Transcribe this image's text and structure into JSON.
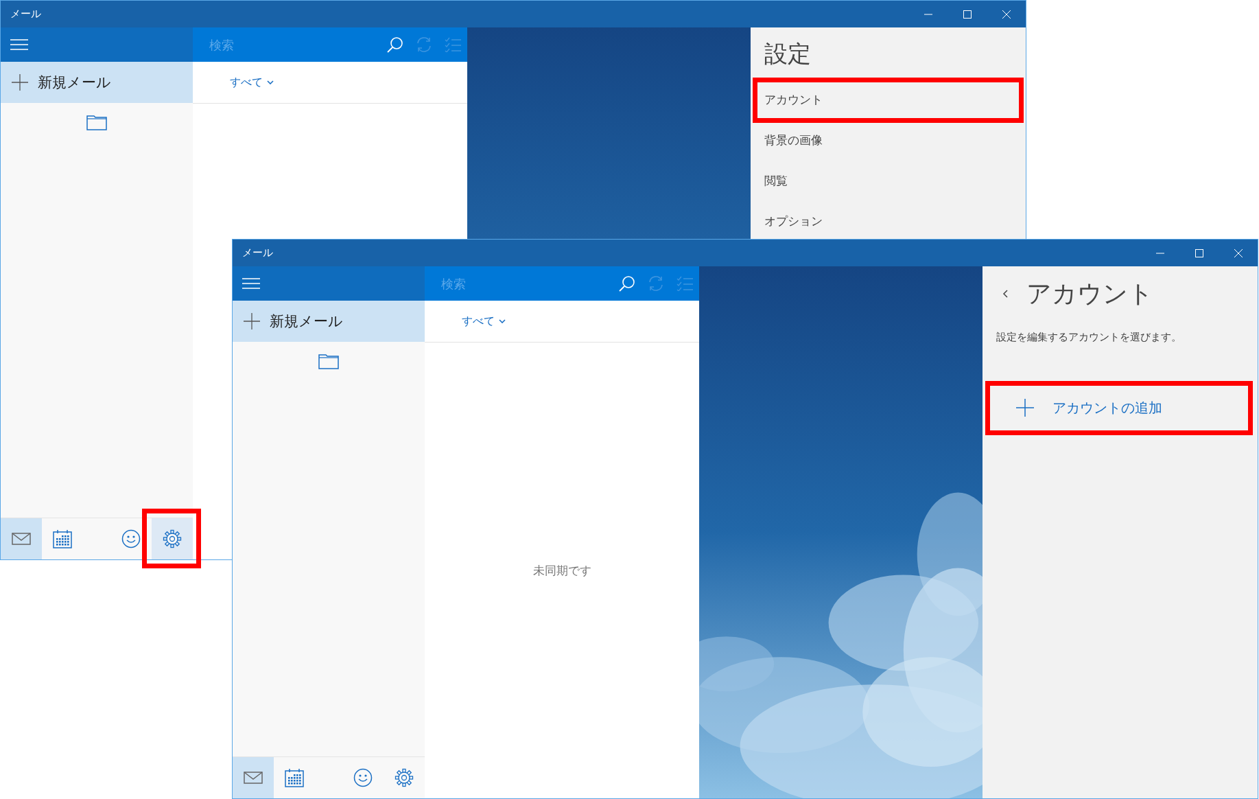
{
  "windows": [
    {
      "title": "メール",
      "new_mail": "新規メール",
      "search": {
        "placeholder": "検索"
      },
      "filter": "すべて",
      "nav": [
        {
          "kind": "mail",
          "selected": true,
          "hovered": false
        },
        {
          "kind": "calendar",
          "selected": false,
          "hovered": false
        },
        {
          "kind": "people",
          "selected": false,
          "hovered": false
        },
        {
          "kind": "settings",
          "selected": false,
          "hovered": true,
          "highlighted": true
        }
      ],
      "panel": {
        "kind": "menu",
        "title": "設定",
        "items": [
          {
            "label": "アカウント",
            "highlighted": true
          },
          {
            "label": "背景の画像",
            "highlighted": false
          },
          {
            "label": "閲覧",
            "highlighted": false
          },
          {
            "label": "オプション",
            "highlighted": false
          }
        ]
      }
    },
    {
      "title": "メール",
      "new_mail": "新規メール",
      "search": {
        "placeholder": "検索"
      },
      "filter": "すべて",
      "status": "未同期です",
      "nav": [
        {
          "kind": "mail",
          "selected": true,
          "hovered": false
        },
        {
          "kind": "calendar",
          "selected": false,
          "hovered": false
        },
        {
          "kind": "people",
          "selected": false,
          "hovered": false
        },
        {
          "kind": "settings",
          "selected": false,
          "hovered": false
        }
      ],
      "panel": {
        "kind": "accounts",
        "title": "アカウント",
        "description": "設定を編集するアカウントを選びます。",
        "add_account": "アカウントの追加",
        "highlighted": true
      }
    }
  ]
}
